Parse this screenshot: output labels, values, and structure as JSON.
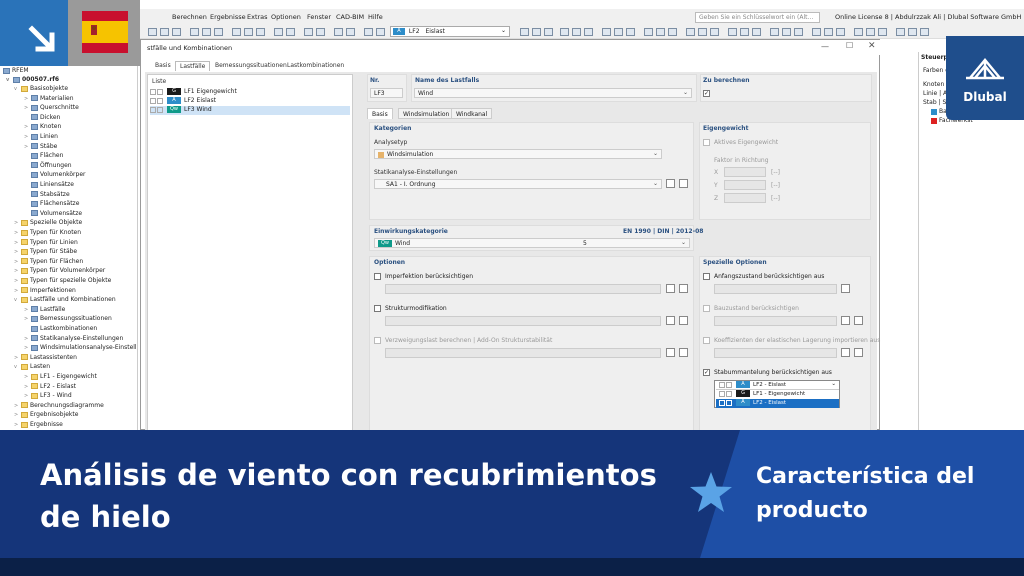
{
  "menu": [
    "Berechnen",
    "Ergebnisse",
    "Extras",
    "Optionen",
    "Fenster",
    "CAD-BIM",
    "Hilfe"
  ],
  "search_placeholder": "Geben Sie ein Schlüsselwort ein (Alt...",
  "license": "Online License 8 | Abdulrzzak Ali | Dlubal Software GmbH",
  "toolbar_loadcase": {
    "badge": "A",
    "code": "LF2",
    "name": "Eislast"
  },
  "tree": {
    "root": "RFEM",
    "file": "000507.rf6",
    "items": [
      {
        "t": "Basisobjekte",
        "i": "folder",
        "l": 1,
        "exp": "v"
      },
      {
        "t": "Materialien",
        "i": "ticon",
        "l": 2,
        "exp": ">"
      },
      {
        "t": "Querschnitte",
        "i": "ticon",
        "l": 2,
        "exp": ">"
      },
      {
        "t": "Dicken",
        "i": "ticon",
        "l": 2,
        "exp": ""
      },
      {
        "t": "Knoten",
        "i": "ticon",
        "l": 2,
        "exp": ">"
      },
      {
        "t": "Linien",
        "i": "ticon",
        "l": 2,
        "exp": ">"
      },
      {
        "t": "Stäbe",
        "i": "ticon",
        "l": 2,
        "exp": ">"
      },
      {
        "t": "Flächen",
        "i": "ticon",
        "l": 2,
        "exp": ""
      },
      {
        "t": "Öffnungen",
        "i": "ticon",
        "l": 2,
        "exp": ""
      },
      {
        "t": "Volumenkörper",
        "i": "ticon",
        "l": 2,
        "exp": ""
      },
      {
        "t": "Liniensätze",
        "i": "ticon",
        "l": 2,
        "exp": ""
      },
      {
        "t": "Stabsätze",
        "i": "ticon",
        "l": 2,
        "exp": ""
      },
      {
        "t": "Flächensätze",
        "i": "ticon",
        "l": 2,
        "exp": ""
      },
      {
        "t": "Volumensätze",
        "i": "ticon",
        "l": 2,
        "exp": ""
      },
      {
        "t": "Spezielle Objekte",
        "i": "folder",
        "l": 1,
        "exp": ">"
      },
      {
        "t": "Typen für Knoten",
        "i": "folder",
        "l": 1,
        "exp": ">"
      },
      {
        "t": "Typen für Linien",
        "i": "folder",
        "l": 1,
        "exp": ">"
      },
      {
        "t": "Typen für Stäbe",
        "i": "folder",
        "l": 1,
        "exp": ">"
      },
      {
        "t": "Typen für Flächen",
        "i": "folder",
        "l": 1,
        "exp": ">"
      },
      {
        "t": "Typen für Volumenkörper",
        "i": "folder",
        "l": 1,
        "exp": ">"
      },
      {
        "t": "Typen für spezielle Objekte",
        "i": "folder",
        "l": 1,
        "exp": ">"
      },
      {
        "t": "Imperfektionen",
        "i": "folder",
        "l": 1,
        "exp": ">"
      },
      {
        "t": "Lastfälle und Kombinationen",
        "i": "folder",
        "l": 1,
        "exp": "v"
      },
      {
        "t": "Lastfälle",
        "i": "ticon",
        "l": 2,
        "exp": ">"
      },
      {
        "t": "Bemessungssituationen",
        "i": "ticon",
        "l": 2,
        "exp": ">"
      },
      {
        "t": "Lastkombinationen",
        "i": "ticon",
        "l": 2,
        "exp": ""
      },
      {
        "t": "Statikanalyse-Einstellungen",
        "i": "ticon",
        "l": 2,
        "exp": ">"
      },
      {
        "t": "Windsimulationsanalyse-Einstellu",
        "i": "ticon",
        "l": 2,
        "exp": ">"
      },
      {
        "t": "Lastassistenten",
        "i": "folder",
        "l": 1,
        "exp": ">"
      },
      {
        "t": "Lasten",
        "i": "folder",
        "l": 1,
        "exp": "v"
      },
      {
        "t": "LF1 - Eigengewicht",
        "i": "folder",
        "l": 2,
        "exp": ">"
      },
      {
        "t": "LF2 - Eislast",
        "i": "folder",
        "l": 2,
        "exp": ">"
      },
      {
        "t": "LF3 - Wind",
        "i": "folder",
        "l": 2,
        "exp": ">"
      },
      {
        "t": "Berechnungsdiagramme",
        "i": "folder",
        "l": 1,
        "exp": ">"
      },
      {
        "t": "Ergebnisobjekte",
        "i": "folder",
        "l": 1,
        "exp": ">"
      },
      {
        "t": "Ergebnisse",
        "i": "folder",
        "l": 1,
        "exp": ">"
      }
    ]
  },
  "dialog": {
    "title": "stfälle und Kombinationen",
    "tabs": [
      "Basis",
      "Lastfälle",
      "Bemessungssituationen",
      "Lastkombinationen"
    ],
    "list_title": "Liste",
    "list": [
      {
        "badge": "G",
        "cls": "g",
        "code": "LF1",
        "name": "Eigengewicht"
      },
      {
        "badge": "A",
        "cls": "a",
        "code": "LF2",
        "name": "Eislast"
      },
      {
        "badge": "Qw",
        "cls": "qw",
        "code": "LF3",
        "name": "Wind"
      }
    ],
    "nr_label": "Nr.",
    "nr_value": "LF3",
    "name_label": "Name des Lastfalls",
    "name_value": "Wind",
    "calc_label": "Zu berechnen",
    "calc_check": "✓",
    "subtabs": [
      "Basis",
      "Windsimulation",
      "Windkanal"
    ],
    "kategorien": "Kategorien",
    "analysetyp_label": "Analysetyp",
    "analysetyp_value": "Windsimulation",
    "statik_label": "Statikanalyse-Einstellungen",
    "statik_value": "SA1 - I. Ordnung",
    "eigengewicht": "Eigengewicht",
    "aktives": "Aktives Eigengewicht",
    "faktor": "Faktor in Richtung",
    "axes": [
      "X",
      "Y",
      "Z"
    ],
    "unit": "[--]",
    "einwirkung_label": "Einwirkungskategorie",
    "norm": "EN 1990 | DIN | 2012-08",
    "einwirkung_badge": "Qw",
    "einwirkung_value": "Wind",
    "einwirkung_num": "5",
    "optionen": "Optionen",
    "opt1": "Imperfektion berücksichtigen",
    "opt2": "Strukturmodifikation",
    "opt3": "Verzweigungslast berechnen | Add-On Strukturstabilität",
    "spezielle": "Spezielle Optionen",
    "sp1": "Anfangszustand berücksichtigen aus",
    "sp2": "Bauzustand berücksichtigen",
    "sp3": "Koeffizienten der elastischen Lagerung importieren aus",
    "sp4": "Stabummantelung berücksichtigen aus",
    "sp4_selected": "LF2 - Eislast",
    "dd_options": [
      {
        "badge": "G",
        "cls": "g",
        "text": "LF1 - Eigengewicht"
      },
      {
        "badge": "A",
        "cls": "a",
        "text": "LF2 - Eislast"
      }
    ]
  },
  "rightpane": {
    "title": "Steuerpa",
    "farben": "Farben d",
    "knoten": "Knoten",
    "linie": "Linie | Ar",
    "stab": "Stab | Stab",
    "items": [
      {
        "c": "#2e8dc9",
        "t": "Balkens"
      },
      {
        "c": "#d22",
        "t": "Fachwerkst"
      }
    ]
  },
  "logo": "Dlubal",
  "banner": {
    "title_line1": "Análisis de viento con recubrimientos",
    "title_line2": "de hielo",
    "feature_line1": "Característica del",
    "feature_line2": "producto"
  },
  "colors": {
    "banner": "#15357a",
    "accent": "#1e4fa6",
    "corner": "#2a73b9"
  }
}
